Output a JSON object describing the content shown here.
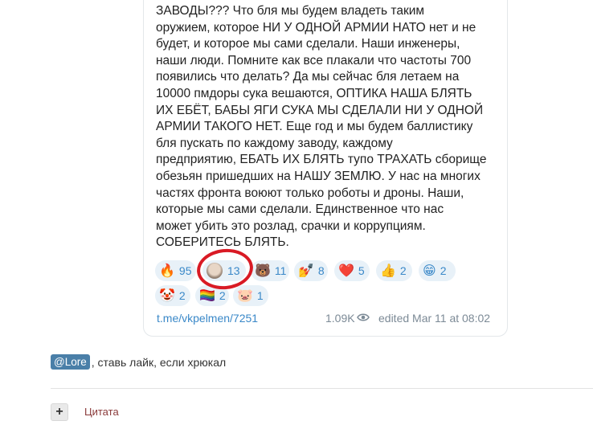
{
  "post": {
    "lines": [
      "ЗАВОДЫ??? Что бля мы будем владеть таким",
      "оружием, которое НИ У ОДНОЙ АРМИИ НАТО нет и не",
      "будет, и которое мы сами сделали. Наши инженеры,",
      "наши люди. Помните как все плакали что частоты 700",
      "появились что делать? Да мы сейчас бля летаем на",
      "10000 пмдоры сука вешаются, ОПТИКА НАША БЛЯТЬ",
      "ИХ ЕБЁТ, БАБЫ ЯГИ СУКА МЫ СДЕЛАЛИ НИ У ОДНОЙ",
      "АРМИИ ТАКОГО НЕТ. Еще год и мы будем баллистику",
      "бля пускать по каждому заводу, каждому",
      "предприятию, ЕБАТЬ ИХ БЛЯТЬ тупо ТРАХАТЬ сборище",
      "обезьян пришедших на НАШУ ЗЕМЛЮ. У нас на многих",
      "частях фронта воюют только роботы и дроны. Наши,",
      "которые мы сами сделали. Единственное что нас",
      "может убить это розлад, срачки и коррупциям.",
      "СОБЕРИТЕСЬ БЛЯТЬ."
    ],
    "reactions": [
      {
        "icon": "🔥",
        "name": "fire",
        "count": "95"
      },
      {
        "icon": "",
        "name": "face-avatar",
        "count": "13"
      },
      {
        "icon": "🐻",
        "name": "bear",
        "count": "11"
      },
      {
        "icon": "💅",
        "name": "object",
        "count": "8"
      },
      {
        "icon": "❤️",
        "name": "heart",
        "count": "5"
      },
      {
        "icon": "👍",
        "name": "thumbs-up",
        "count": "2"
      },
      {
        "icon": "😁",
        "name": "grin",
        "count": "2"
      },
      {
        "icon": "🤡",
        "name": "clown",
        "count": "2"
      },
      {
        "icon": "🏳️‍🌈",
        "name": "rainbow-flag",
        "count": "2"
      },
      {
        "icon": "🐷",
        "name": "pig",
        "count": "1"
      }
    ],
    "link": "t.me/vkpelmen/7251",
    "views": "1.09K",
    "edited": "edited  Mar 11 at 08:02"
  },
  "comment": {
    "mention": "@Lore",
    "text": ", ставь лайк, если хрюкал"
  },
  "quote": {
    "plus": "+",
    "label": "Цитата"
  },
  "colors": {
    "link": "#3a88c8",
    "reaction_bg": "#e8f1f8",
    "annotation": "#d91a24",
    "mention_bg": "#4a7fa8"
  }
}
